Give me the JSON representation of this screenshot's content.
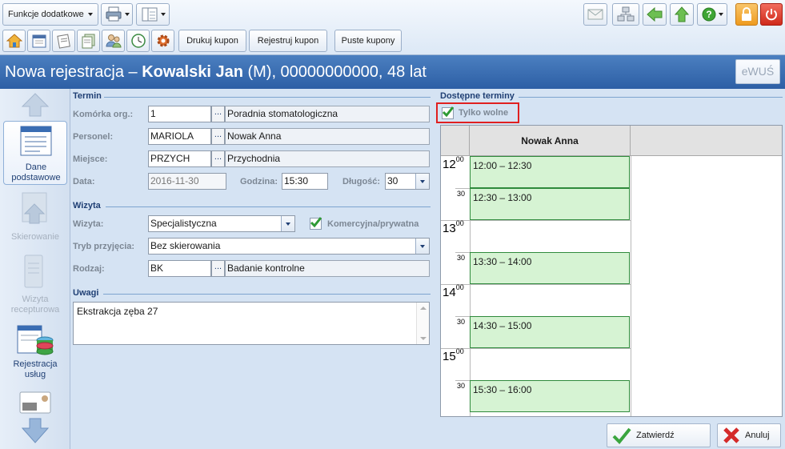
{
  "toolbar": {
    "functions_label": "Funkcje dodatkowe",
    "print_kupon": "Drukuj kupon",
    "register_kupon": "Rejestruj kupon",
    "empty_kupons": "Puste kupony"
  },
  "header": {
    "prefix": "Nowa rejestracja – ",
    "patient_name": "Kowalski Jan",
    "patient_details": " (M), 00000000000, 48 lat",
    "ewus_label": "eWUŚ"
  },
  "nav": {
    "items": [
      {
        "label": "Dane podstawowe",
        "icon": "form-icon",
        "active": true
      },
      {
        "label": "Skierowanie",
        "icon": "referral-icon",
        "active": false
      },
      {
        "label": "Wizyta recepturowa",
        "icon": "prescription-icon",
        "active": false
      },
      {
        "label": "Rejestracja usług",
        "icon": "services-db-icon",
        "active": false
      }
    ]
  },
  "termin": {
    "section_title": "Termin",
    "komorka_label": "Komórka org.:",
    "komorka_code": "1",
    "komorka_name": "Poradnia stomatologiczna",
    "personel_label": "Personel:",
    "personel_code": "MARIOLA",
    "personel_name": "Nowak Anna",
    "miejsce_label": "Miejsce:",
    "miejsce_code": "PRZYCH",
    "miejsce_name": "Przychodnia",
    "data_label": "Data:",
    "data_value": "2016-11-30",
    "godzina_label": "Godzina:",
    "godzina_value": "15:30",
    "dlugosc_label": "Długość:",
    "dlugosc_value": "30",
    "dots": "..."
  },
  "wizyta": {
    "section_title": "Wizyta",
    "wizyta_label": "Wizyta:",
    "wizyta_value": "Specjalistyczna",
    "komercyjna_label": "Komercyjna/prywatna",
    "komercyjna_checked": true,
    "tryb_label": "Tryb przyjęcia:",
    "tryb_value": "Bez skierowania",
    "rodzaj_label": "Rodzaj:",
    "rodzaj_code": "BK",
    "rodzaj_name": "Badanie kontrolne"
  },
  "uwagi": {
    "section_title": "Uwagi",
    "text": "Ekstrakcja zęba 27"
  },
  "terminy": {
    "section_title": "Dostępne terminy",
    "tylko_wolne_label": "Tylko wolne",
    "tylko_wolne_checked": true,
    "column_header": "Nowak Anna",
    "hours": [
      "12",
      "13",
      "14",
      "15"
    ],
    "minute_sup": "00",
    "half_label": "30",
    "slots": [
      "12:00 – 12:30",
      "12:30 – 13:00",
      "13:30 – 14:00",
      "14:30 – 15:00",
      "15:30 – 16:00"
    ]
  },
  "actions": {
    "confirm_label": "Zatwierdź",
    "cancel_label": "Anuluj"
  },
  "colors": {
    "title_bar": "#3a6db3",
    "slot_fill": "#d6f3d3",
    "slot_border": "#2f8a3c",
    "highlight_red": "#e02020"
  }
}
